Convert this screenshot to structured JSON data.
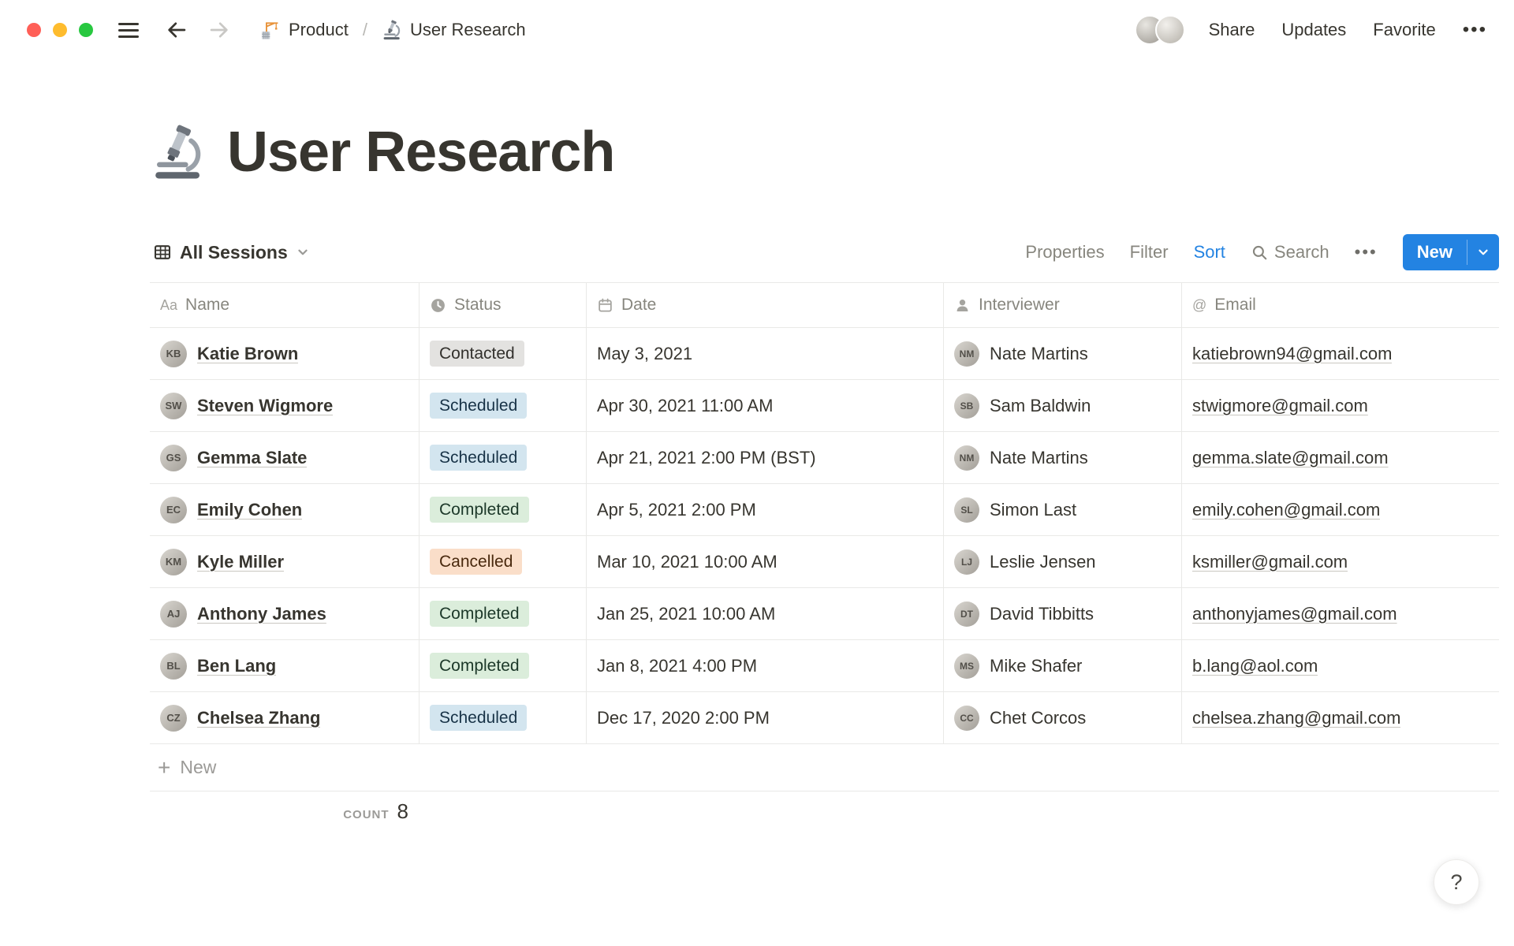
{
  "topbar": {
    "breadcrumb": [
      {
        "icon": "construction-crane",
        "label": "Product"
      },
      {
        "icon": "microscope",
        "label": "User Research"
      }
    ],
    "separator": "/",
    "actions": [
      "Share",
      "Updates",
      "Favorite"
    ],
    "more_label": "•••"
  },
  "page": {
    "icon": "microscope",
    "title": "User Research"
  },
  "toolbar": {
    "view_label": "All Sessions",
    "properties_label": "Properties",
    "filter_label": "Filter",
    "sort_label": "Sort",
    "search_label": "Search",
    "more_label": "•••",
    "new_label": "New",
    "accent_color": "#2383E2"
  },
  "table": {
    "columns": [
      {
        "icon": "text",
        "label": "Name"
      },
      {
        "icon": "status",
        "label": "Status"
      },
      {
        "icon": "calendar",
        "label": "Date"
      },
      {
        "icon": "person",
        "label": "Interviewer"
      },
      {
        "icon": "at-sign",
        "label": "Email"
      }
    ],
    "status_styles": {
      "Contacted": {
        "bg": "#E3E2E0",
        "text": "#32302C"
      },
      "Scheduled": {
        "bg": "#D3E5EF",
        "text": "#183347"
      },
      "Completed": {
        "bg": "#DBEDDB",
        "text": "#1C3829"
      },
      "Cancelled": {
        "bg": "#FADEC9",
        "text": "#49290E"
      }
    },
    "rows": [
      {
        "name": "Katie Brown",
        "status": "Contacted",
        "date": "May 3, 2021",
        "interviewer": "Nate Martins",
        "email": "katiebrown94@gmail.com"
      },
      {
        "name": "Steven Wigmore",
        "status": "Scheduled",
        "date": "Apr 30, 2021 11:00 AM",
        "interviewer": "Sam Baldwin",
        "email": "stwigmore@gmail.com"
      },
      {
        "name": "Gemma Slate",
        "status": "Scheduled",
        "date": "Apr 21, 2021 2:00 PM (BST)",
        "interviewer": "Nate Martins",
        "email": "gemma.slate@gmail.com"
      },
      {
        "name": "Emily Cohen",
        "status": "Completed",
        "date": "Apr 5, 2021 2:00 PM",
        "interviewer": "Simon Last",
        "email": "emily.cohen@gmail.com"
      },
      {
        "name": "Kyle Miller",
        "status": "Cancelled",
        "date": "Mar 10, 2021 10:00 AM",
        "interviewer": "Leslie Jensen",
        "email": "ksmiller@gmail.com"
      },
      {
        "name": "Anthony James",
        "status": "Completed",
        "date": "Jan 25, 2021 10:00 AM",
        "interviewer": "David Tibbitts",
        "email": "anthonyjames@gmail.com"
      },
      {
        "name": "Ben Lang",
        "status": "Completed",
        "date": "Jan 8, 2021 4:00 PM",
        "interviewer": "Mike Shafer",
        "email": "b.lang@aol.com"
      },
      {
        "name": "Chelsea Zhang",
        "status": "Scheduled",
        "date": "Dec 17, 2020 2:00 PM",
        "interviewer": "Chet Corcos",
        "email": "chelsea.zhang@gmail.com"
      }
    ],
    "new_row_label": "New",
    "footer": {
      "count_label": "COUNT",
      "count_value": "8"
    }
  },
  "help_label": "?"
}
